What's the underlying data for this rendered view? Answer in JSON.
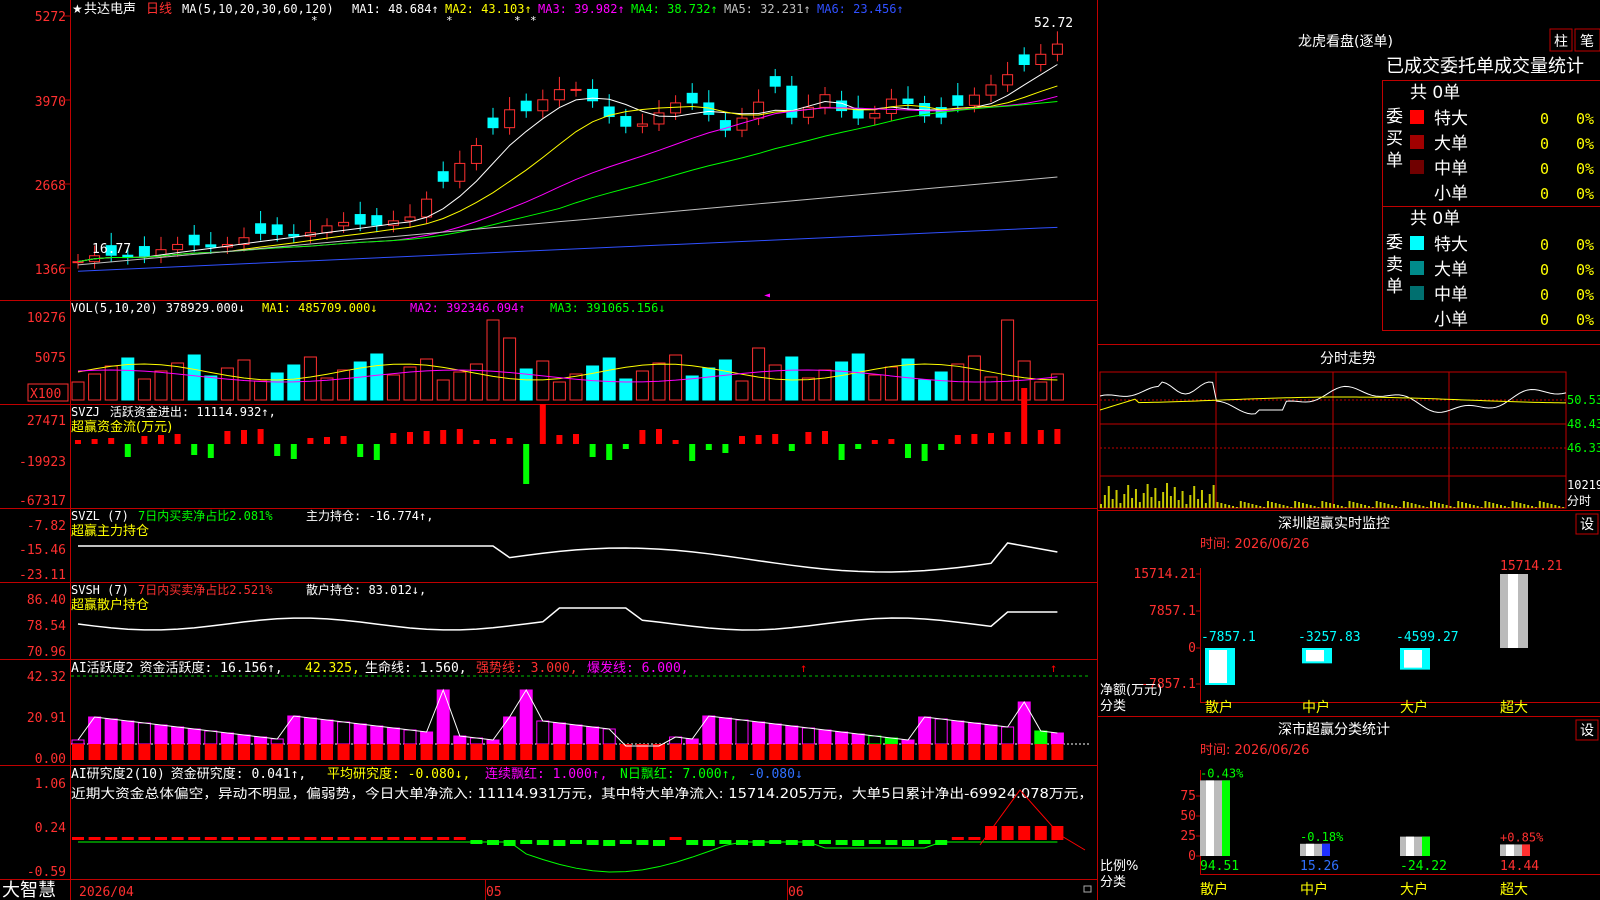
{
  "main": {
    "star": "★",
    "stock": "共达电声",
    "period": "日线",
    "ma_header": "MA(5,10,20,30,60,120)",
    "ma_values": [
      {
        "label": "MA1:",
        "value": "48.684↑",
        "color": "#ffffff"
      },
      {
        "label": "MA2:",
        "value": "43.103↑",
        "color": "#ffff00"
      },
      {
        "label": "MA3:",
        "value": "39.982↑",
        "color": "#ff00ff"
      },
      {
        "label": "MA4:",
        "value": "38.732↑",
        "color": "#00ff00"
      },
      {
        "label": "MA5:",
        "value": "32.231↑",
        "color": "#c0c0c0"
      },
      {
        "label": "MA6:",
        "value": "23.456↑",
        "color": "#3050ff"
      }
    ],
    "price_axis": [
      "5272",
      "3970",
      "2668",
      "1366"
    ],
    "high_label": "52.72",
    "low_label": "16.77",
    "date_labels": [
      "2026/04",
      "05",
      "06"
    ],
    "brand": "大智慧"
  },
  "vol": {
    "header": "VOL(5,10,20)",
    "value": "378929.000↓",
    "ma1": "MA1: 485709.000↓",
    "ma2": "MA2: 392346.094↑",
    "ma3": "MA3: 391065.156↓",
    "axis": [
      "10276",
      "5075"
    ],
    "unit": "X100"
  },
  "svzj": {
    "header": "SVZJ",
    "text": "活跃资金进出: 11114.932↑,",
    "sub": "超赢资金流(万元)",
    "axis": [
      "27471",
      "-19923",
      "-67317"
    ]
  },
  "svzl": {
    "header": "SVZL (7)",
    "text": "7日内买卖净占比2.081%",
    "text2": "主力持仓: -16.774↑,",
    "sub": "超赢主力持仓",
    "axis": [
      "-7.82",
      "-15.46",
      "-23.11"
    ]
  },
  "svsh": {
    "header": "SVSH (7)",
    "text": "7日内买卖净占比2.521%",
    "text2": "散户持仓: 83.012↓,",
    "sub": "超赢散户持仓",
    "axis": [
      "86.40",
      "78.54",
      "70.96"
    ]
  },
  "ai1": {
    "header": "AI活跃度2",
    "a": "资金活跃度: 16.156↑,",
    "b": "42.325,",
    "c": "生命线: 1.560,",
    "d": "强势线: 3.000,",
    "e": "爆发线: 6.000,",
    "axis": [
      "42.32",
      "20.91",
      "0.00"
    ]
  },
  "ai2": {
    "header": "AI研究度2(10)",
    "a": "资金研究度: 0.041↑,",
    "b": "平均研究度: -0.080↓,",
    "c": "连续飘红: 1.000↑,",
    "d": "N日飘红: 7.000↑,",
    "e": "-0.080↓",
    "note": "近期大资金总体偏空，异动不明显，偏弱势，今日大单净流入: 11114.931万元，其中特大单净流入: 15714.205万元，大单5日累计净出-69924.078万元，",
    "axis": [
      "1.06",
      "0.24",
      "-0.59"
    ]
  },
  "right": {
    "lhb_title": "龙虎看盘(逐单)",
    "btn1": "柱",
    "btn2": "笔",
    "tabs": "已成交委托单成交量统计",
    "buy_group": {
      "label": "委买单",
      "total": "共 0单",
      "rows": [
        {
          "name": "特大",
          "color": "#ff0000",
          "count": "0",
          "pct": "0%"
        },
        {
          "name": "大单",
          "color": "#a00000",
          "count": "0",
          "pct": "0%"
        },
        {
          "name": "中单",
          "color": "#700000",
          "count": "0",
          "pct": "0%"
        },
        {
          "name": "小单",
          "color": "",
          "count": "0",
          "pct": "0%"
        }
      ]
    },
    "sell_group": {
      "label": "委卖单",
      "total": "共 0单",
      "rows": [
        {
          "name": "特大",
          "color": "#00ffff",
          "count": "0",
          "pct": "0%"
        },
        {
          "name": "大单",
          "color": "#008b8b",
          "count": "0",
          "pct": "0%"
        },
        {
          "name": "中单",
          "color": "#006f6f",
          "count": "0",
          "pct": "0%"
        },
        {
          "name": "小单",
          "color": "",
          "count": "0",
          "pct": "0%"
        }
      ]
    },
    "fs_title": "分时走势",
    "fs_axis": [
      "50.53",
      "48.43",
      "46.33"
    ],
    "fs_vol": "10219",
    "fs_vol_label": "分时",
    "monitor_title": "深圳超赢实时监控",
    "set_label": "设",
    "monitor_time": "时间: 2026/06/26",
    "monitor_axis": [
      "15714.21",
      "7857.1",
      "0",
      "-7857.1"
    ],
    "monitor_ylabel": "净额(万元)",
    "monitor_xlabel": "分类",
    "monitor_bars": [
      {
        "cat": "散户",
        "value": "-7857.1"
      },
      {
        "cat": "中户",
        "value": "-3257.83"
      },
      {
        "cat": "大户",
        "value": "-4599.27"
      },
      {
        "cat": "超大",
        "value": "15714.21"
      }
    ],
    "stats_title": "深市超赢分类统计",
    "stats_time": "时间: 2026/06/26",
    "stats_axis": [
      "75",
      "50",
      "25",
      "0"
    ],
    "stats_ylabel": "比例%",
    "stats_xlabel": "分类",
    "stats_bars": [
      {
        "cat": "散户",
        "top": "-0.43%",
        "bottom": "94.51"
      },
      {
        "cat": "中户",
        "top": "-0.18%",
        "bottom": "15.26"
      },
      {
        "cat": "大户",
        "top": "",
        "bottom": "-24.22"
      },
      {
        "cat": "超大",
        "top": "+0.85%",
        "bottom": "14.44"
      }
    ]
  },
  "chart_data": {
    "type": "candlestick",
    "title": "共达电声 日线",
    "y_axis_ticks": [
      1366,
      2668,
      3970,
      5272
    ],
    "high": 52.72,
    "low": 16.77,
    "ma_periods": [
      5,
      10,
      20,
      30,
      60,
      120
    ],
    "ma_last": [
      48.684,
      43.103,
      39.982,
      38.732,
      32.231,
      23.456
    ],
    "volume_last": 378929.0,
    "volume_ma_last": [
      485709.0,
      392346.094,
      391065.156
    ],
    "x_labels": [
      "2026/04",
      "05",
      "06"
    ]
  }
}
